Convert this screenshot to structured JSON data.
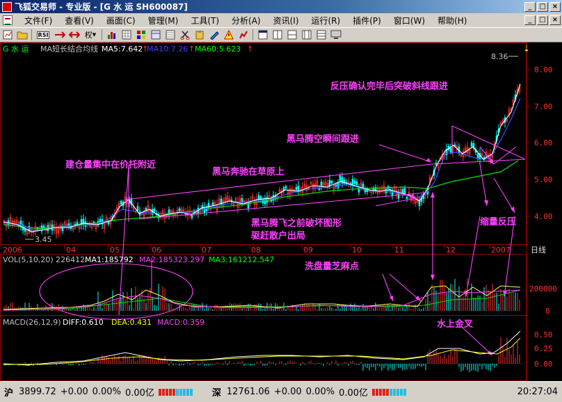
{
  "window": {
    "title": "飞狐交易师 - 专业版 - [G 水 运 SH600087]",
    "min_label": "_",
    "max_label": "□",
    "close_label": "×"
  },
  "menu": {
    "items": [
      "文件(F)",
      "查看(V)",
      "画面(C)",
      "管理(M)",
      "工具(T)",
      "分析(A)",
      "资讯(I)",
      "运行(R)",
      "插件(P)",
      "窗口(W)",
      "帮助(H)"
    ],
    "right_buttons": [
      "_",
      "□",
      "×"
    ]
  },
  "toolbar": {
    "icons": [
      "chart-icon",
      "folder-icon",
      "rsi-icon",
      "swap-icon",
      "arrows-icon",
      "right-icon",
      "bar-chart-icon",
      "grid-icon",
      "tile-icon",
      "layout-icon",
      "table-icon",
      "cut-icon",
      "paste-icon",
      "draw-icon",
      "alert-icon",
      "chart-style-icon",
      "window-icon",
      "split-v-icon",
      "split-h-icon",
      "compare-icon",
      "pattern-icon",
      "monitor-icon"
    ],
    "rsi_label": "RSI",
    "rights_label": "权"
  },
  "price_panel": {
    "stock_label": "G 水 运",
    "indicator_label": "MA短长结合均线",
    "ma5": "MA5:7.642",
    "ma10": "MA10:7.26",
    "ma60": "MA60:5.623",
    "up_arrow": "↑",
    "y_axis": [
      "8.00",
      "7.00",
      "6.00",
      "5.00",
      "4.00"
    ],
    "high_label": "8.36",
    "low_label": "3.45",
    "colors": {
      "ma5": "#ffffff",
      "ma10": "#4040ff",
      "ma60": "#00e000",
      "annotation": "#ff40ff",
      "up": "#ff3030",
      "down": "#00ffff"
    }
  },
  "annotations": {
    "a1": "反压确认完毕后突破斜线跟进",
    "a2": "黑马腾空瞬间跟进",
    "a3": "建仓量集中在价托附近",
    "a4": "黑马奔驰在草原上",
    "a5": "黑马腾飞之前破坏图形",
    "a6": "驱赶散户出局",
    "a7": "缩量反压",
    "a8": "洗盘量芝麻点",
    "a9": "水上金叉"
  },
  "time_axis": {
    "labels": [
      "2006",
      "04",
      "05",
      "06",
      "07",
      "08",
      "09",
      "10",
      "11",
      "12",
      "2007"
    ],
    "period": "日线"
  },
  "volume_panel": {
    "label": "VOL(5,10,20) 226412",
    "ma1": "MA1:185792",
    "ma2": "MA2:185323.297",
    "ma3": "MA3:161212.547",
    "y_axis": [
      "200000",
      "0"
    ]
  },
  "macd_panel": {
    "label": "MACD(26,12,9)",
    "diff": "DIFF:0.610",
    "dea": "DEA:0.431",
    "macd": "MACD:0.359",
    "y_axis": [
      "0.50",
      "0.25",
      "0.00"
    ]
  },
  "status": {
    "sh_label": "沪",
    "sh_index": "3899.72",
    "sh_change": "+0.00",
    "sh_pct": "0.00%",
    "sh_amount": "0.00亿",
    "sz_label": "深",
    "sz_index": "12761.06",
    "sz_change": "+0.00",
    "sz_pct": "0.00%",
    "sz_amount": "0.00亿",
    "time": "20:27:04"
  }
}
